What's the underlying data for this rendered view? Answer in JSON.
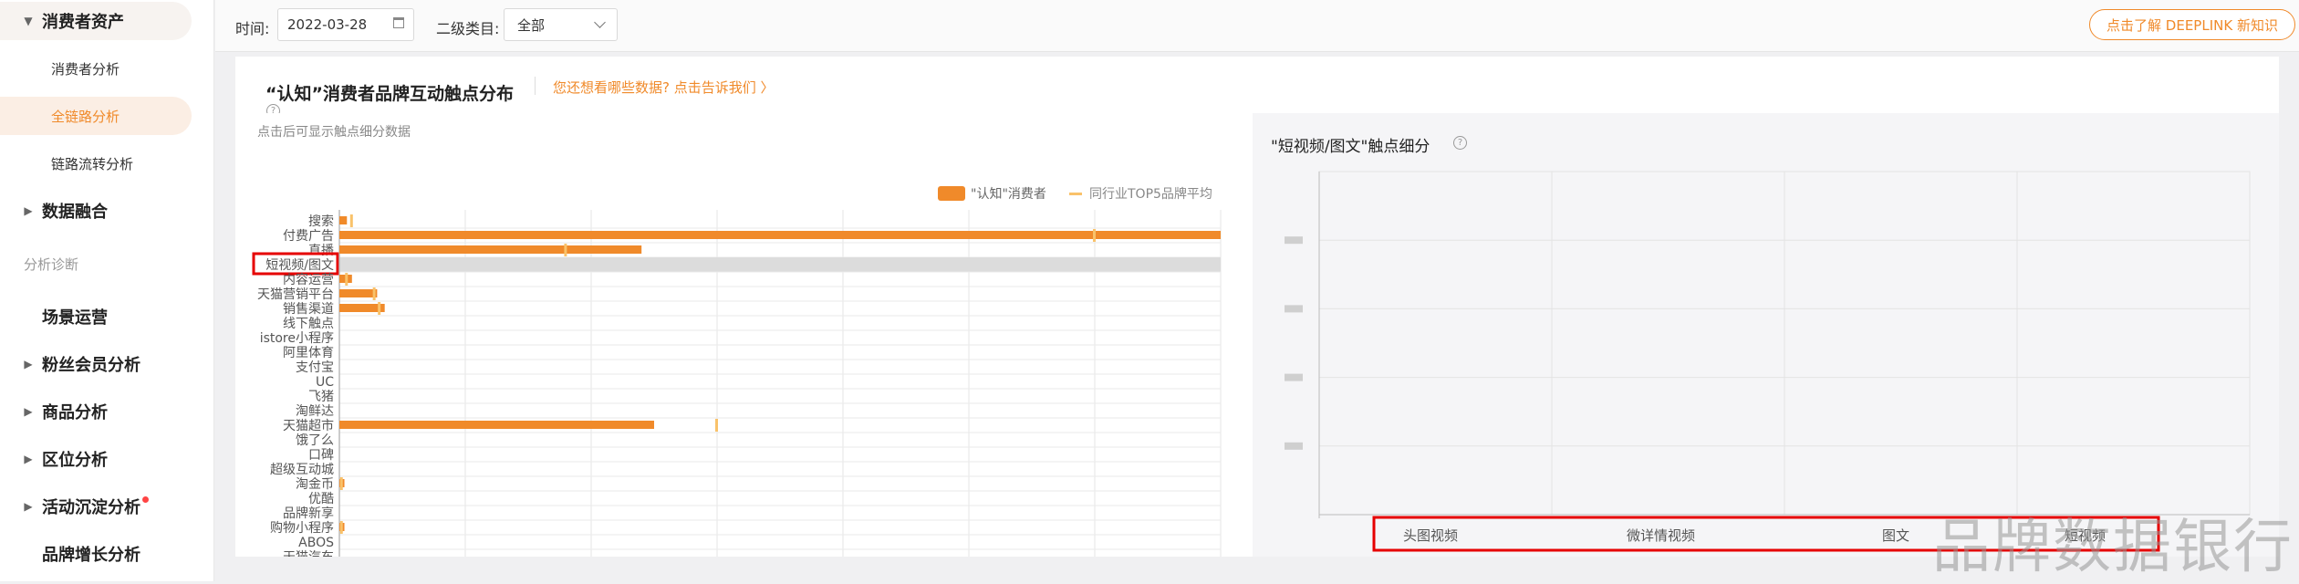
{
  "sidebar": {
    "items": [
      {
        "label": "消费者资产",
        "kind": "group",
        "caret": "down"
      },
      {
        "label": "消费者分析",
        "kind": "sub"
      },
      {
        "label": "全链路分析",
        "kind": "sub-selected"
      },
      {
        "label": "链路流转分析",
        "kind": "sub"
      },
      {
        "label": "数据融合",
        "kind": "group",
        "caret": "right"
      },
      {
        "label": "分析诊断",
        "kind": "section"
      },
      {
        "label": "场景运营",
        "kind": "group"
      },
      {
        "label": "粉丝会员分析",
        "kind": "group",
        "caret": "right"
      },
      {
        "label": "商品分析",
        "kind": "group",
        "caret": "right"
      },
      {
        "label": "区位分析",
        "kind": "group",
        "caret": "right"
      },
      {
        "label": "活动沉淀分析",
        "kind": "group",
        "caret": "right",
        "badge": true
      },
      {
        "label": "品牌增长分析",
        "kind": "group"
      }
    ]
  },
  "toolbar": {
    "time_label": "时间:",
    "date_value": "2022-03-28",
    "category_label": "二级类目:",
    "category_value": "全部",
    "deeplink_label": "点击了解 DEEPLINK 新知识"
  },
  "panel": {
    "title": "“认知”消费者品牌互动触点分布",
    "link": "您还想看哪些数据? 点击告诉我们 〉",
    "hint": "点击后可显示触点细分数据",
    "right_title": "\"短视频/图文\"触点细分"
  },
  "chart_data": [
    {
      "type": "bar",
      "orientation": "horizontal",
      "legend": {
        "items": [
          "\"认知\"消费者",
          "同行业TOP5品牌平均"
        ],
        "position": "top-right"
      },
      "series_colors": [
        "#f08a2a",
        "#f9c26a"
      ],
      "highlighted_category": "短视频/图文",
      "categories": [
        "搜索",
        "付费广告",
        "直播",
        "短视频/图文",
        "内容运营",
        "天猫营销平台",
        "销售渠道",
        "线下触点",
        "istore小程序",
        "阿里体育",
        "支付宝",
        "UC",
        "飞猪",
        "淘鲜达",
        "天猫超市",
        "饿了么",
        "口碑",
        "超级互动城",
        "淘金币",
        "优酷",
        "品牌新享",
        "购物小程序",
        "ABOS",
        "天猫汽车"
      ],
      "series": [
        {
          "name": "\"认知\"消费者",
          "values": [
            0.3,
            35,
            12,
            0,
            0.5,
            1.5,
            1.8,
            0,
            0,
            0,
            0,
            0,
            0,
            0,
            12.5,
            0,
            0,
            0,
            0.2,
            0,
            0,
            0.2,
            0,
            0
          ]
        },
        {
          "name": "同行业TOP5品牌平均",
          "values": [
            0.5,
            30,
            9,
            0,
            0.3,
            1.4,
            1.6,
            0,
            0,
            0,
            0,
            0,
            0,
            0,
            15,
            0,
            0,
            0,
            0.1,
            0,
            0,
            0.1,
            0,
            0
          ]
        }
      ],
      "xlim": [
        0,
        35
      ]
    },
    {
      "type": "scatter",
      "title": "\"短视频/图文\"触点细分",
      "categories": [
        "头图视频",
        "微详情视频",
        "图文",
        "短视频"
      ],
      "grid": true
    }
  ]
}
